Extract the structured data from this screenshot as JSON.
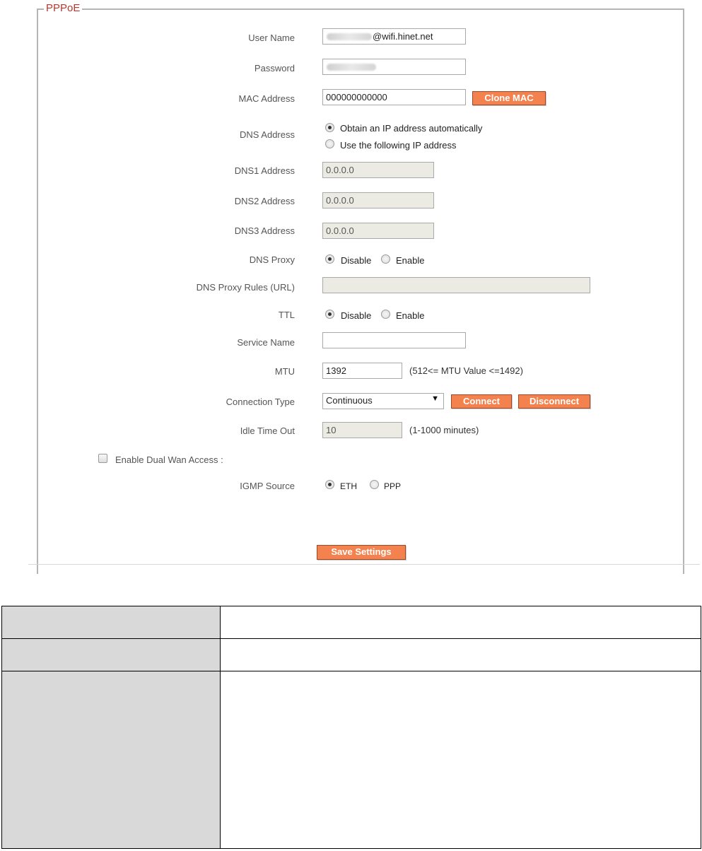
{
  "legend": "PPPoE",
  "user_name": {
    "label": "User Name",
    "value_visible": "@wifi.hinet.net"
  },
  "password": {
    "label": "Password"
  },
  "mac": {
    "label": "MAC Address",
    "value": "000000000000",
    "clone_label": "Clone MAC"
  },
  "dns": {
    "label": "DNS  Address",
    "options": [
      "Obtain an IP address automatically",
      "Use the following IP address"
    ],
    "selected": 0,
    "dns1": {
      "label": "DNS1  Address",
      "value": "0.0.0.0"
    },
    "dns2": {
      "label": "DNS2  Address",
      "value": "0.0.0.0"
    },
    "dns3": {
      "label": "DNS3  Address",
      "value": "0.0.0.0"
    }
  },
  "dns_proxy": {
    "label": "DNS Proxy",
    "options": [
      "Disable",
      "Enable"
    ],
    "selected": 0
  },
  "dns_proxy_rules": {
    "label": "DNS Proxy Rules (URL)",
    "value": ""
  },
  "ttl": {
    "label": "TTL",
    "options": [
      "Disable",
      "Enable"
    ],
    "selected": 0
  },
  "service_name": {
    "label": "Service Name",
    "value": ""
  },
  "mtu": {
    "label": "MTU",
    "value": "1392",
    "hint": "(512<= MTU  Value <=1492)"
  },
  "connection_type": {
    "label": "Connection Type",
    "selected": "Continuous",
    "connect_label": "Connect",
    "disconnect_label": "Disconnect"
  },
  "idle_timeout": {
    "label": "Idle Time Out",
    "value": "10",
    "hint": "(1-1000 minutes)"
  },
  "dual_wan": {
    "label": "Enable  Dual Wan Access  :",
    "checked": false
  },
  "igmp": {
    "label": "IGMP Source",
    "options": [
      "ETH",
      "PPP"
    ],
    "selected": 0
  },
  "save_label": "Save Settings",
  "table_rows": 3
}
